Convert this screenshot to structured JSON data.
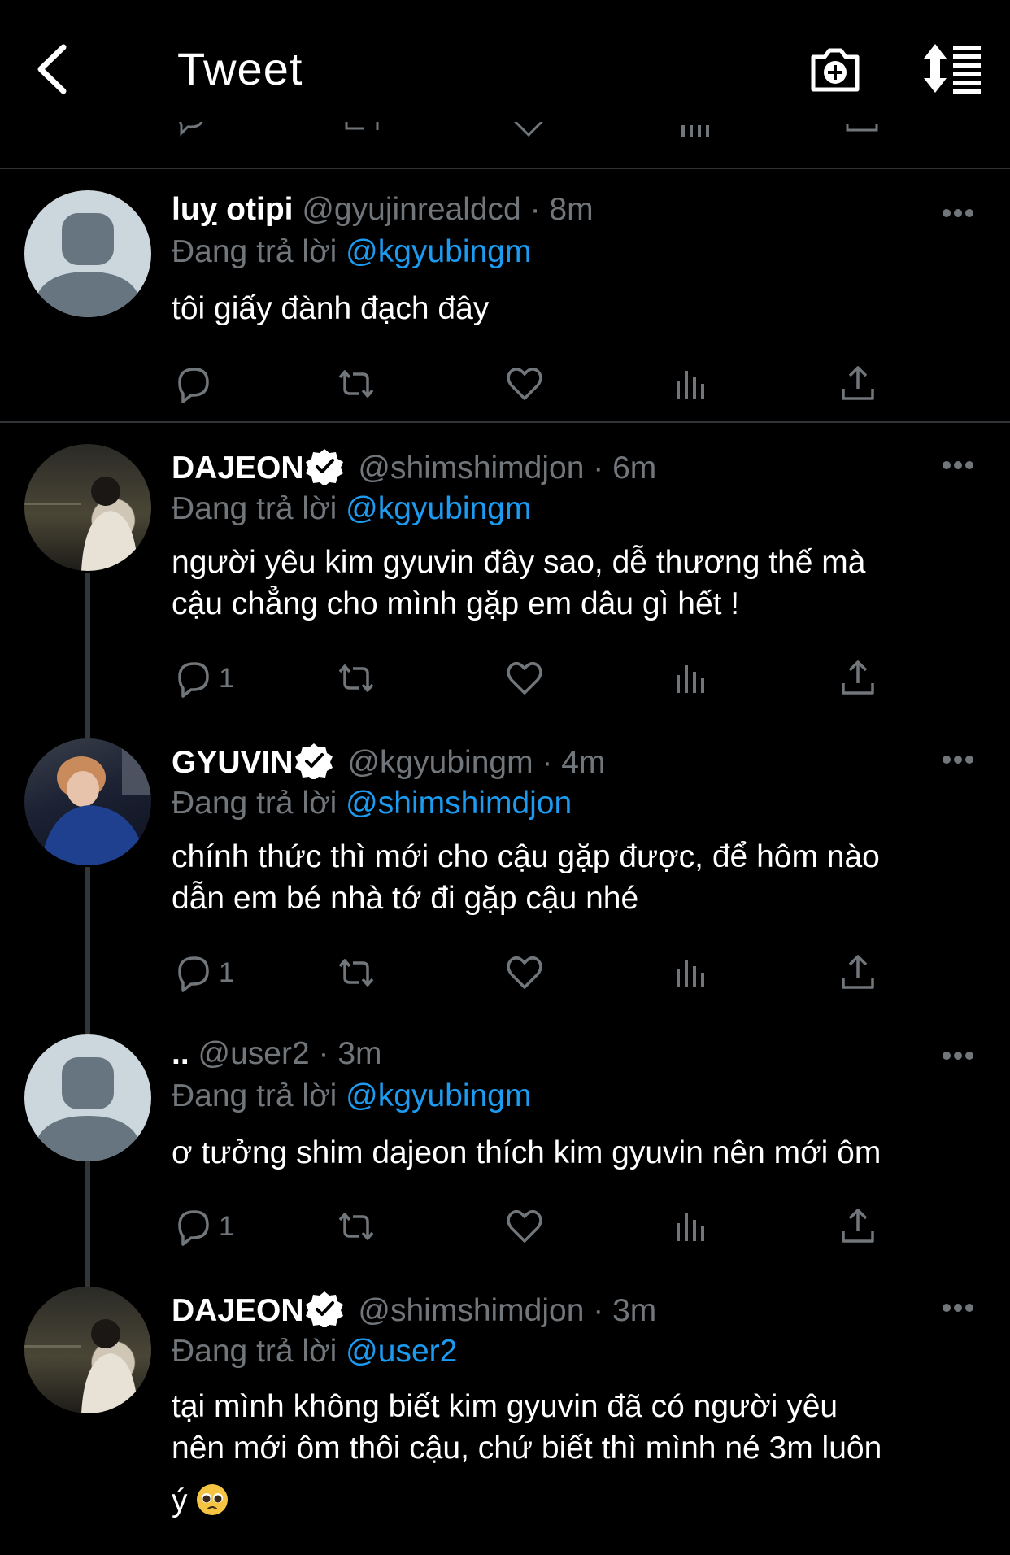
{
  "header": {
    "title": "Tweet"
  },
  "tweets": [
    {
      "name": "luỵ otipi",
      "handle": "@gyujinrealdcd",
      "time": "· 8m",
      "reply_prefix": "Đang trả lời",
      "reply_to": "@kgyubingm",
      "text": "tôi giấy đành đạch đây",
      "reply_count": ""
    },
    {
      "name": "DAJEON",
      "handle": "@shimshimdjon",
      "time": "· 6m",
      "reply_prefix": "Đang trả lời",
      "reply_to": "@kgyubingm",
      "text_line1": "người yêu kim gyuvin đây sao, dễ thương thế mà",
      "text_line2": "cậu chẳng cho mình gặp em dâu gì hết !",
      "reply_count": "1"
    },
    {
      "name": "GYUVIN",
      "handle": "@kgyubingm",
      "time": "· 4m",
      "reply_prefix": "Đang trả lời",
      "reply_to": "@shimshimdjon",
      "text_line1": "chính thức thì mới cho cậu gặp được, để hôm nào",
      "text_line2": "dẫn em bé nhà tớ đi gặp cậu nhé",
      "reply_count": "1"
    },
    {
      "name": "..",
      "handle": "@user2",
      "time": "· 3m",
      "reply_prefix": "Đang trả lời",
      "reply_to": "@kgyubingm",
      "text": "ơ tưởng shim dajeon thích kim gyuvin nên mới ôm",
      "reply_count": "1"
    },
    {
      "name": "DAJEON",
      "handle": "@shimshimdjon",
      "time": "· 3m",
      "reply_prefix": "Đang trả lời",
      "reply_to": "@user2",
      "text_line1": "tại mình không biết kim gyuvin đã có người yêu",
      "text_line2": "nên mới ôm thôi cậu, chứ biết thì mình né 3m luôn",
      "text_line3": "ý",
      "reply_count": ""
    }
  ],
  "icons": {
    "back": "chevron-left-icon",
    "camera": "camera-plus-icon",
    "sort": "sort-icon",
    "reply": "reply-icon",
    "retweet": "retweet-icon",
    "like": "heart-icon",
    "views": "views-icon",
    "share": "share-icon",
    "more": "more-icon",
    "verified": "verified-badge-icon"
  },
  "colors": {
    "background": "#000000",
    "secondary_text": "#71767b",
    "mention": "#1d9bf0",
    "divider": "#2f3336"
  }
}
